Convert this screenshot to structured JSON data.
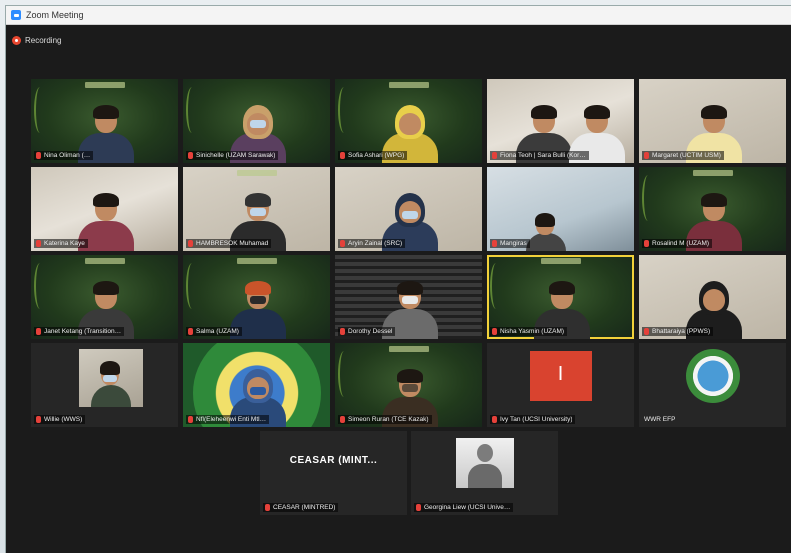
{
  "window": {
    "title": "Zoom Meeting"
  },
  "recording": {
    "label": "Recording"
  },
  "participants": {
    "r1": [
      {
        "name": "Nina Oliman (…"
      },
      {
        "name": "Sinichelle (UZAM Sarawak)"
      },
      {
        "name": "Sofia Ashari (WPG)"
      },
      {
        "name": "Fiona Teoh | Sara Bulli (Kor…"
      },
      {
        "name": "Margaret (UCTIM USM)"
      }
    ],
    "r2": [
      {
        "name": "Katerina Kaye"
      },
      {
        "name": "HAMBRESOK Muhamad"
      },
      {
        "name": "Aryin Zainal (SRC)"
      },
      {
        "name": "Mangiras"
      },
      {
        "name": "Rosalind M (UZAM)"
      }
    ],
    "r3": [
      {
        "name": "Janet Ketang (Transition…"
      },
      {
        "name": "Salma (UZAM)"
      },
      {
        "name": "Dorothy Dessel"
      },
      {
        "name": "Nisha Yasmin (UZAM)"
      },
      {
        "name": "Bhattaraiya (PPWS)"
      }
    ],
    "r4": [
      {
        "name": "Willie (WWS)"
      },
      {
        "name": "Nfl(Eleheenwi Enti Mtl…"
      },
      {
        "name": "Simeon Ruran (TCE Kazak)"
      },
      {
        "name": "Ivy Tan (UCSI University)"
      },
      {
        "name": "WWR EFP"
      }
    ],
    "r5": [
      {
        "name": "CEASAR (MINTRED)",
        "display": "CEASAR (MINT..."
      },
      {
        "name": "Georgina Liew (UCSI Unive…"
      }
    ]
  },
  "colors": {
    "highlight": "#f2d13a",
    "mute": "#e5413a",
    "background": "#1b1b1b"
  }
}
